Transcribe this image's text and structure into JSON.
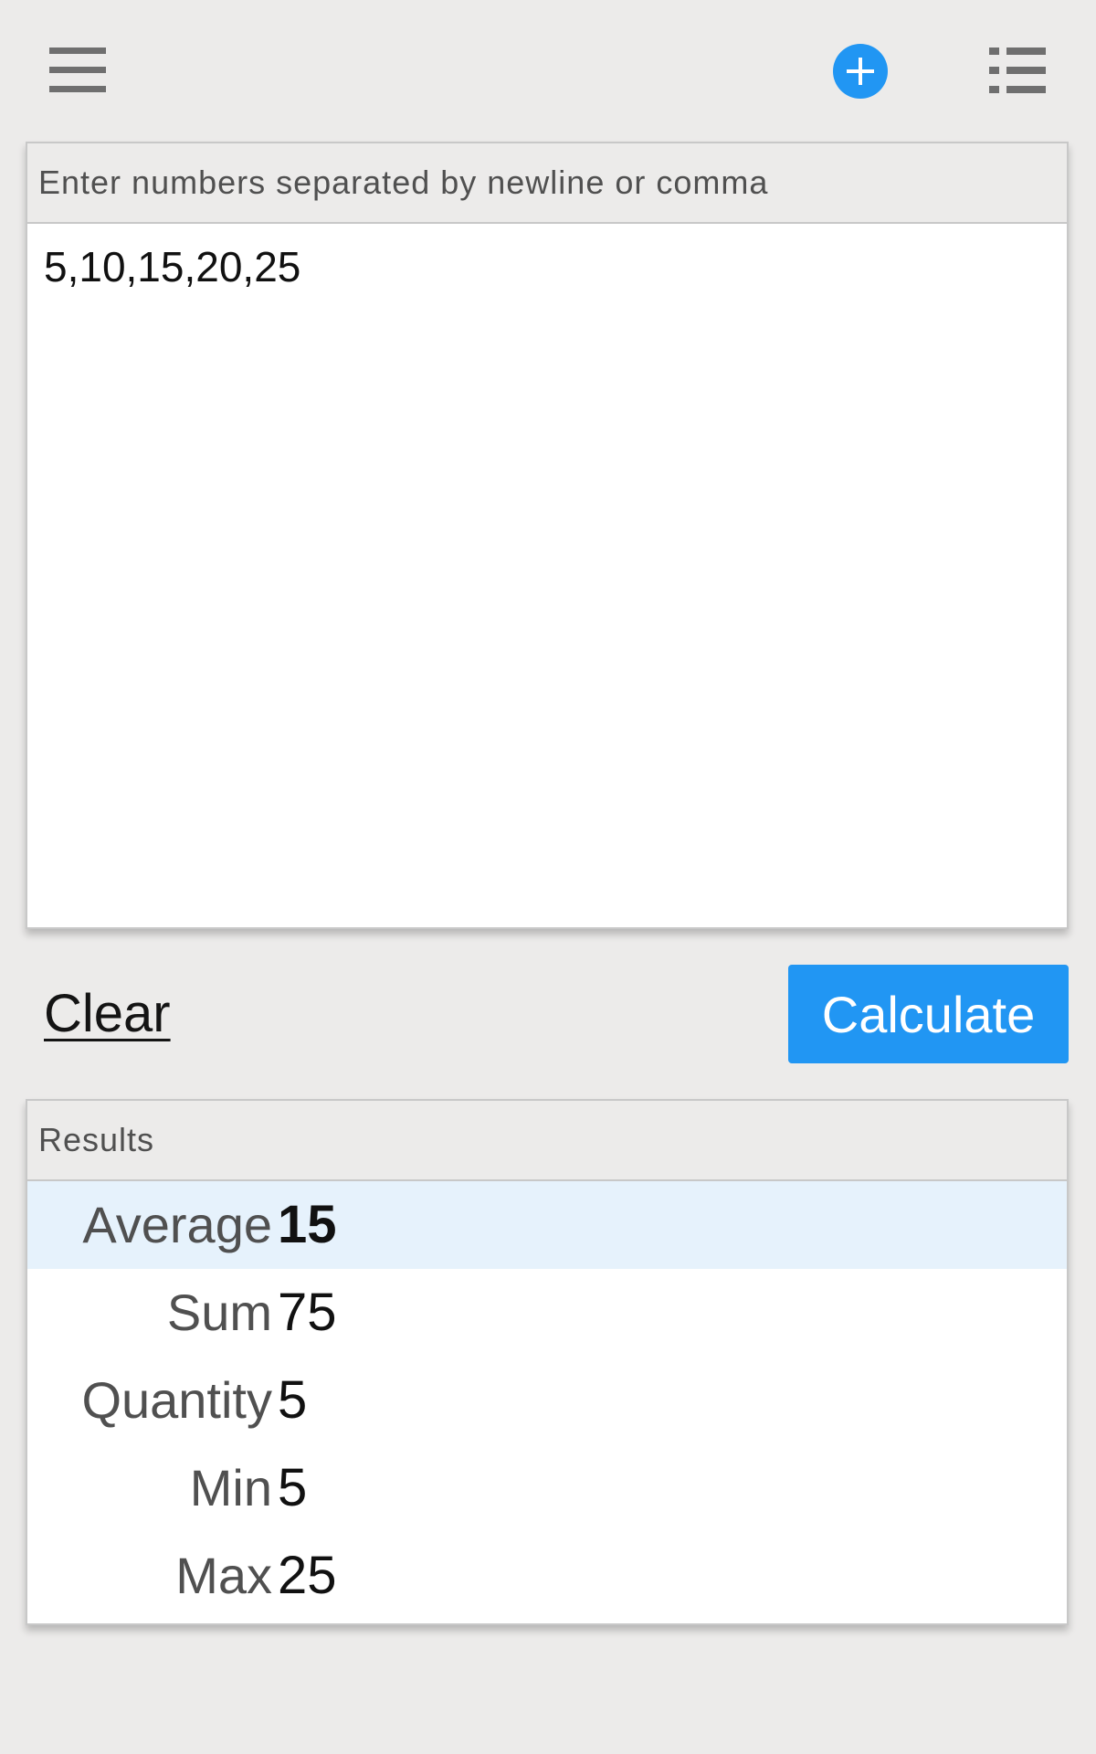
{
  "toolbar": {
    "menu_icon": "hamburger-menu-icon",
    "add_icon": "plus-circle-icon",
    "list_icon": "list-icon",
    "accent_color": "#2196f3"
  },
  "input": {
    "header": "Enter numbers separated by newline or comma",
    "value": "5,10,15,20,25"
  },
  "actions": {
    "clear_label": "Clear",
    "calculate_label": "Calculate"
  },
  "results": {
    "header": "Results",
    "rows": [
      {
        "label": "Average",
        "value": "15"
      },
      {
        "label": "Sum",
        "value": "75"
      },
      {
        "label": "Quantity",
        "value": "5"
      },
      {
        "label": "Min",
        "value": "5"
      },
      {
        "label": "Max",
        "value": "25"
      }
    ]
  }
}
